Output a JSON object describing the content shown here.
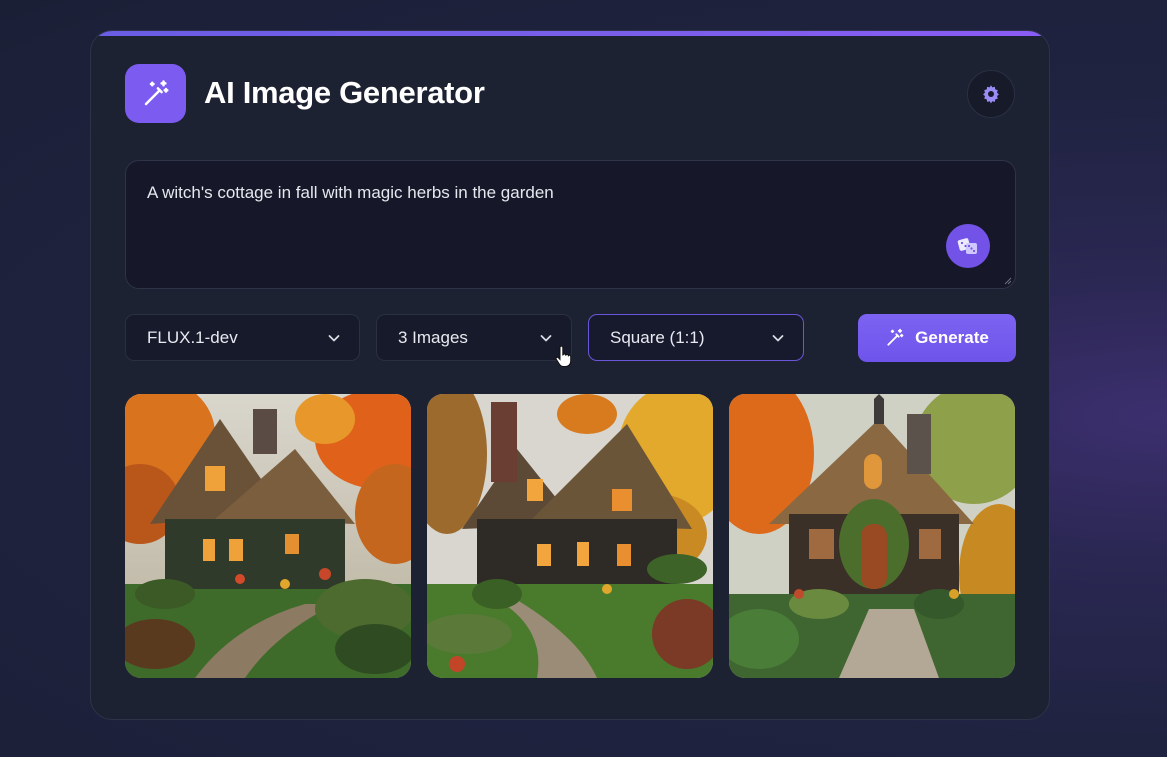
{
  "app": {
    "title": "AI Image Generator",
    "logo_icon": "magic-wand-icon",
    "settings_icon": "gear-icon"
  },
  "prompt": {
    "value": "A witch's cottage in fall with magic herbs in the garden",
    "random_icon": "dice-icon"
  },
  "controls": {
    "model": {
      "selected": "FLUX.1-dev"
    },
    "image_count": {
      "selected": "3 Images"
    },
    "aspect_ratio": {
      "selected": "Square (1:1)"
    },
    "generate_label": "Generate",
    "generate_icon": "magic-wand-icon"
  },
  "gallery": {
    "images": [
      {
        "description_icon": "image-thumbnail"
      },
      {
        "description_icon": "image-thumbnail"
      },
      {
        "description_icon": "image-thumbnail"
      }
    ]
  },
  "colors": {
    "accent": "#7c5cf0",
    "card_bg": "#1d2233",
    "input_bg": "#161728",
    "page_bg": "#1b1f36"
  }
}
